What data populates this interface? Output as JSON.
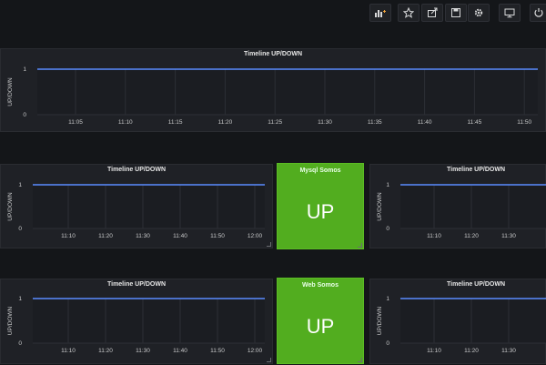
{
  "toolbar": {
    "buttons": [
      {
        "name": "add-panel-button",
        "icon": "add-panel-icon"
      },
      {
        "name": "star-button",
        "icon": "star-icon"
      },
      {
        "name": "share-button",
        "icon": "share-icon"
      },
      {
        "name": "save-button",
        "icon": "save-icon"
      },
      {
        "name": "settings-button",
        "icon": "gear-icon"
      },
      {
        "name": "tv-mode-button",
        "icon": "monitor-icon"
      },
      {
        "name": "refresh-button",
        "icon": "refresh-icon"
      }
    ]
  },
  "colors": {
    "line": "#5a8cff",
    "stat_green": "#52ad1f",
    "grid": "#2c2f35",
    "tick": "#c8c9ca"
  },
  "panels": {
    "top": {
      "title": "Timeline UP/DOWN",
      "ylabel": "UP/DOWN"
    },
    "row2_left": {
      "title": "Timeline UP/DOWN",
      "ylabel": "UP/DOWN"
    },
    "row2_right": {
      "title": "Timeline UP/DOWN",
      "ylabel": "UP/DOWN"
    },
    "row3_left": {
      "title": "Timeline UP/DOWN",
      "ylabel": "UP/DOWN"
    },
    "row3_right": {
      "title": "Timeline UP/DOWN",
      "ylabel": "UP/DOWN"
    }
  },
  "stats": {
    "mysql": {
      "title": "Mysql Somos",
      "value": "UP"
    },
    "web": {
      "title": "Web Somos",
      "value": "UP"
    }
  },
  "chart_data": [
    {
      "id": "top",
      "type": "line",
      "title": "Timeline UP/DOWN",
      "ylabel": "UP/DOWN",
      "x_ticks": [
        "11:05",
        "11:10",
        "11:15",
        "11:20",
        "11:25",
        "11:30",
        "11:35",
        "11:40",
        "11:45",
        "11:50"
      ],
      "y_ticks": [
        "0",
        "1"
      ],
      "ylim": [
        0,
        1
      ],
      "series": [
        {
          "values": [
            1,
            1,
            1,
            1,
            1,
            1,
            1,
            1,
            1,
            1
          ]
        }
      ]
    },
    {
      "id": "row2_left",
      "type": "line",
      "title": "Timeline UP/DOWN",
      "ylabel": "UP/DOWN",
      "x_ticks": [
        "11:10",
        "11:20",
        "11:30",
        "11:40",
        "11:50",
        "12:00"
      ],
      "y_ticks": [
        "0",
        "1"
      ],
      "ylim": [
        0,
        1
      ],
      "series": [
        {
          "values": [
            1,
            1,
            1,
            1,
            1,
            1
          ]
        }
      ]
    },
    {
      "id": "row2_right",
      "type": "line",
      "title": "Timeline UP/DOWN",
      "ylabel": "UP/DOWN",
      "x_ticks": [
        "11:10",
        "11:20",
        "11:30"
      ],
      "y_ticks": [
        "0",
        "1"
      ],
      "ylim": [
        0,
        1
      ],
      "series": [
        {
          "values": [
            1,
            1,
            1
          ]
        }
      ]
    },
    {
      "id": "row3_left",
      "type": "line",
      "title": "Timeline UP/DOWN",
      "ylabel": "UP/DOWN",
      "x_ticks": [
        "11:10",
        "11:20",
        "11:30",
        "11:40",
        "11:50",
        "12:00"
      ],
      "y_ticks": [
        "0",
        "1"
      ],
      "ylim": [
        0,
        1
      ],
      "series": [
        {
          "values": [
            1,
            1,
            1,
            1,
            1,
            1
          ]
        }
      ]
    },
    {
      "id": "row3_right",
      "type": "line",
      "title": "Timeline UP/DOWN",
      "ylabel": "UP/DOWN",
      "x_ticks": [
        "11:10",
        "11:20",
        "11:30"
      ],
      "y_ticks": [
        "0",
        "1"
      ],
      "ylim": [
        0,
        1
      ],
      "series": [
        {
          "values": [
            1,
            1,
            1
          ]
        }
      ]
    }
  ]
}
